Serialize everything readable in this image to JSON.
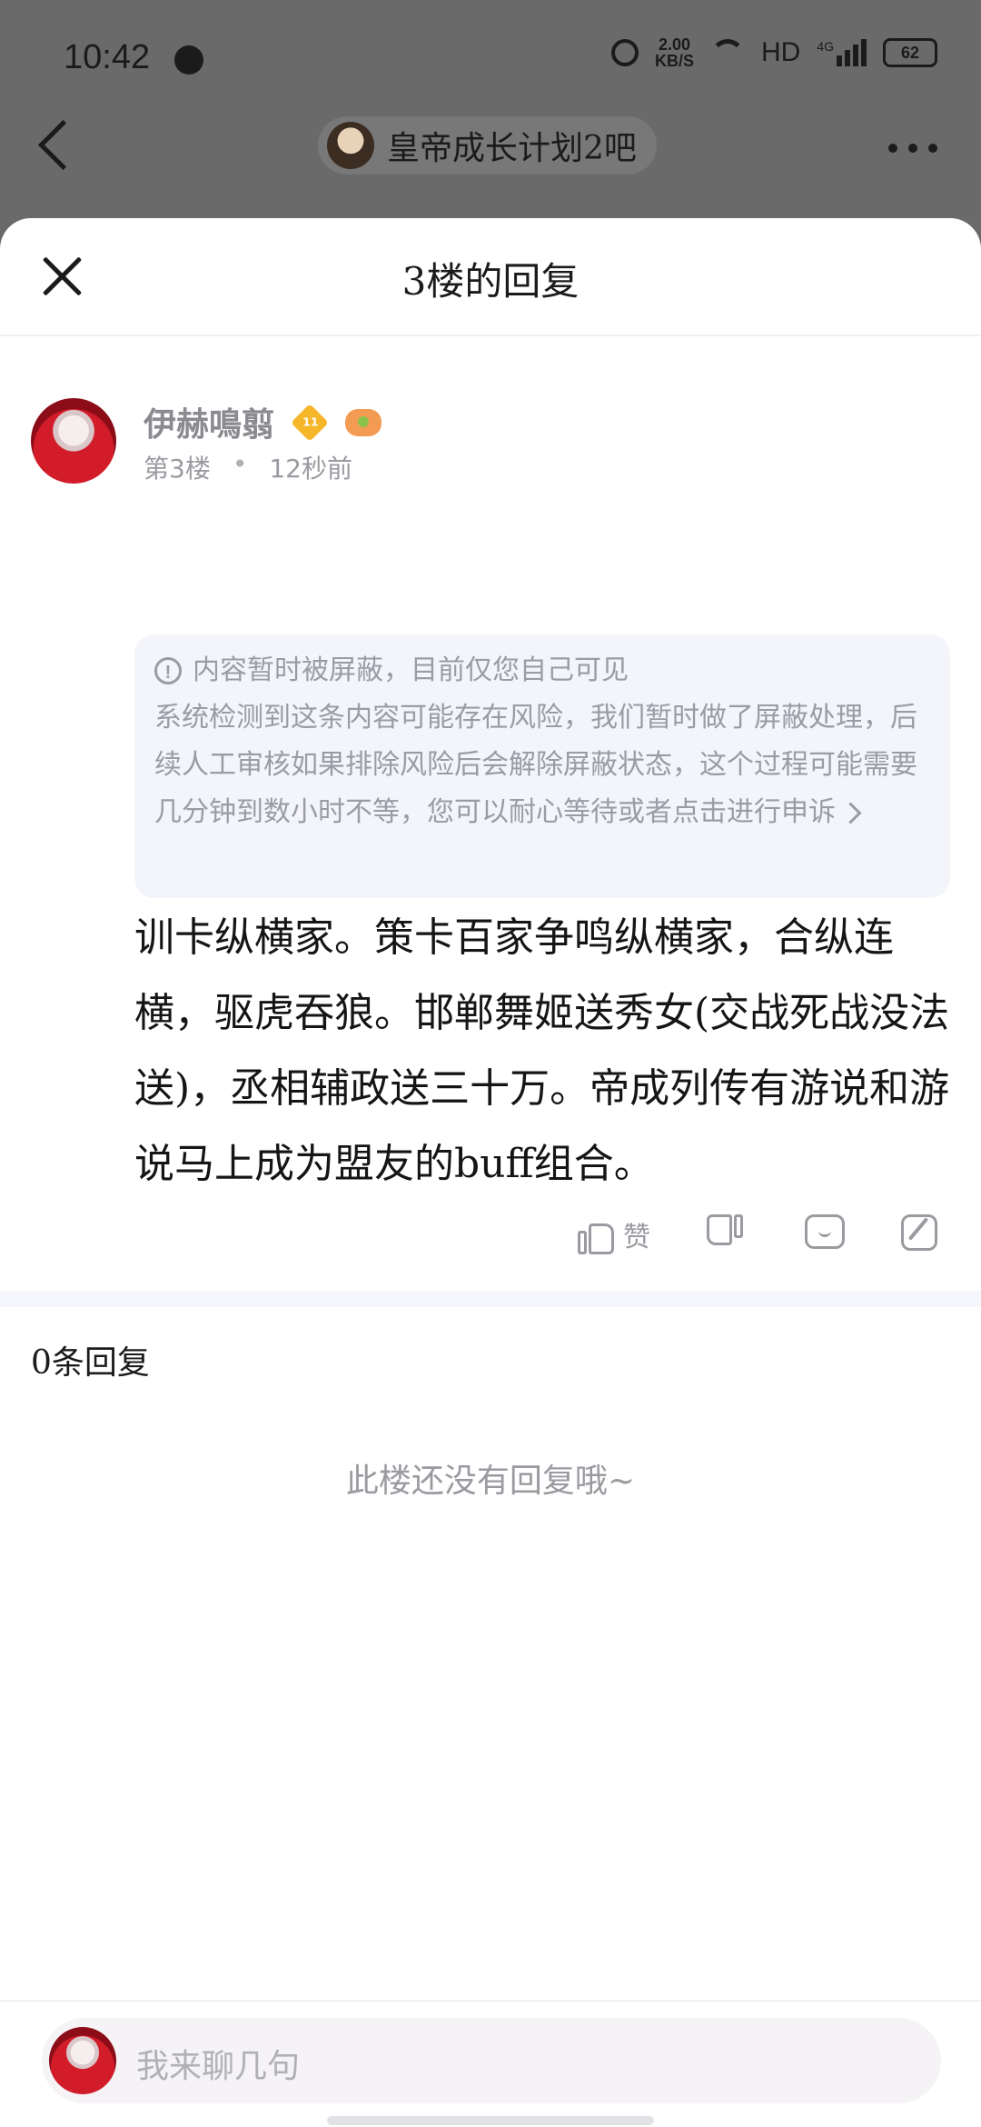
{
  "status_bar": {
    "time": "10:42",
    "net_speed_value": "2.00",
    "net_speed_unit": "KB/S",
    "hd": "HD",
    "network": "4G",
    "battery": "62"
  },
  "top_nav": {
    "forum_name": "皇帝成长计划2吧"
  },
  "sheet": {
    "title": "3楼的回复"
  },
  "post": {
    "username": "伊赫鳴翦",
    "level": "11",
    "floor": "第3楼",
    "separator": "•",
    "time_ago": "12秒前",
    "blocked_notice": {
      "title": "内容暂时被屏蔽，目前仅您自己可见",
      "body": "系统检测到这条内容可能存在风险，我们暂时做了屏蔽处理，后续人工审核如果排除风险后会解除屏蔽状态，这个过程可能需要几分钟到数小时不等，您可以耐心等待或者",
      "appeal_link": "点击进行申诉"
    },
    "content": "训卡纵横家。策卡百家争鸣纵横家，合纵连横，驱虎吞狼。邯郸舞姬送秀女(交战死战没法送)，丞相辅政送三十万。帝成列传有游说和游说马上成为盟友的buff组合。",
    "actions": {
      "like_label": "赞"
    }
  },
  "replies": {
    "count_label": "0条回复",
    "empty_text": "此楼还没有回复哦~"
  },
  "input": {
    "placeholder": "我来聊几句"
  },
  "icons": [
    "globe-icon",
    "alarm-icon",
    "wifi-icon",
    "signal-icon",
    "battery-icon",
    "back-icon",
    "more-icon",
    "close-icon",
    "level-badge-icon",
    "game-icon",
    "info-icon",
    "chevron-right-icon",
    "thumbs-up-icon",
    "thumbs-down-icon",
    "comment-icon",
    "edit-icon"
  ]
}
